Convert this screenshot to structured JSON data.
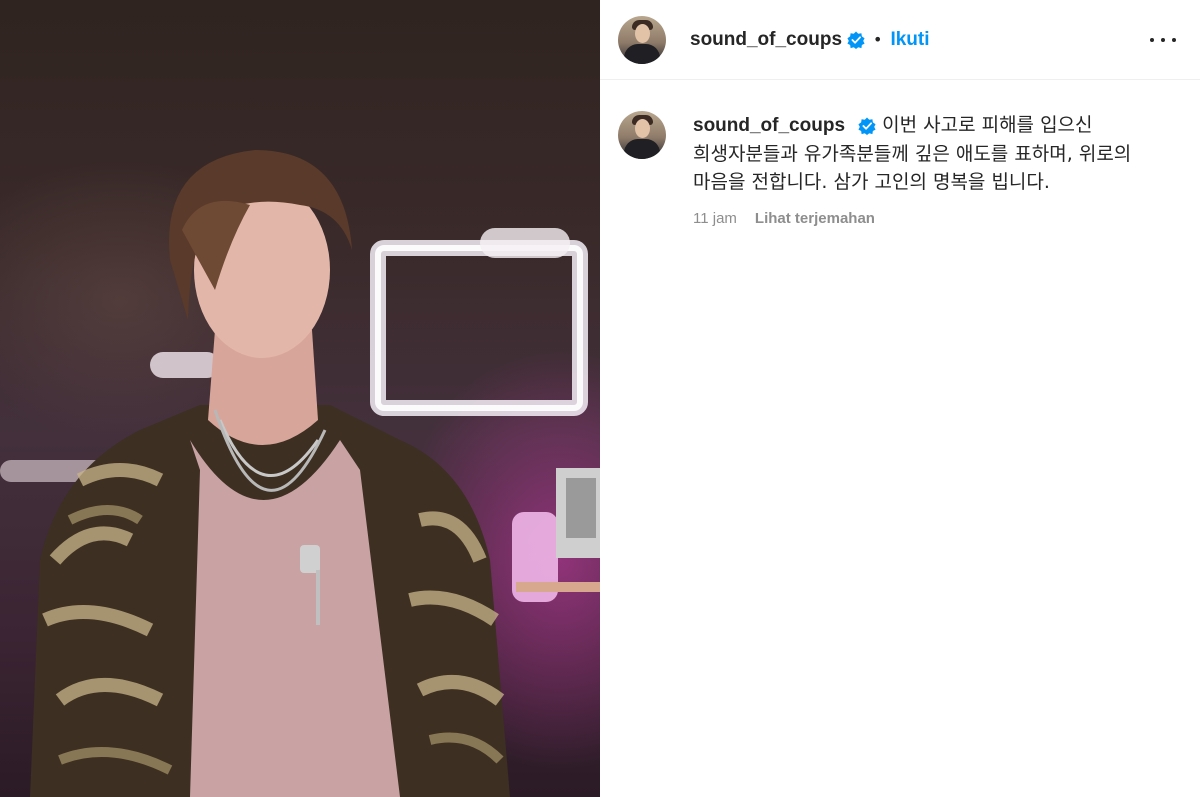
{
  "post": {
    "username": "sound_of_coups",
    "follow_label": "Ikuti",
    "separator": "•",
    "caption_text": "이번 사고로 피해를 입으신 희생자분들과 유가족분들께 깊은 애도를 표하며, 위로의 마음을 전합니다. 삼가 고인의 명복을 빕니다.",
    "timestamp": "11 jam",
    "translate_label": "Lihat terjemahan",
    "verified_icon": "verified-badge-icon",
    "more_icon": "more-options-icon"
  },
  "colors": {
    "accent": "#0095f6",
    "text": "#262626",
    "secondary_text": "#8e8e8e",
    "divider": "#efefef"
  }
}
